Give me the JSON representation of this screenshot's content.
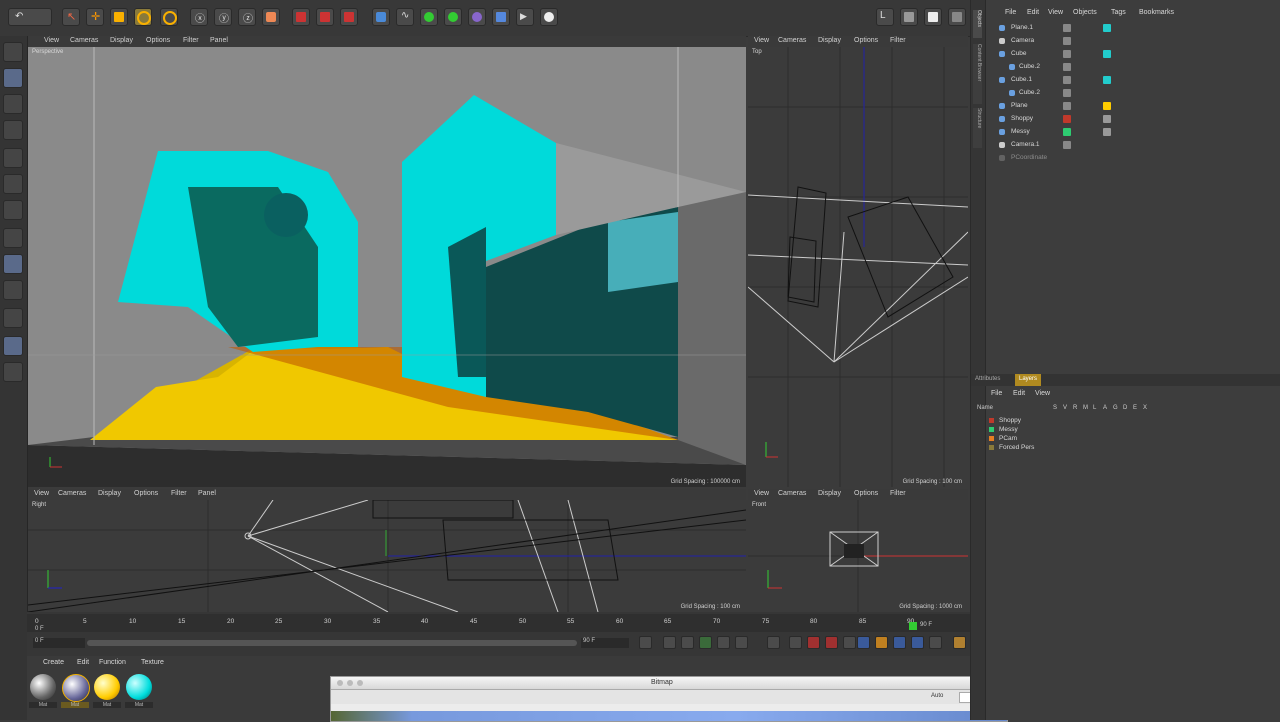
{
  "viewport_menu": [
    "View",
    "Cameras",
    "Display",
    "Options",
    "Filter",
    "Panel"
  ],
  "viewports": {
    "perspective": {
      "label": "Perspective",
      "grid": "Grid Spacing : 100000 cm"
    },
    "top": {
      "label": "Top",
      "grid": "Grid Spacing : 100 cm"
    },
    "right": {
      "label": "Right",
      "grid": "Grid Spacing : 100 cm"
    },
    "front": {
      "label": "Front",
      "grid": "Grid Spacing : 1000 cm"
    }
  },
  "object_manager": {
    "menu": [
      "File",
      "Edit",
      "View",
      "Objects",
      "Tags",
      "Bookmarks"
    ],
    "objects": [
      "Plane.1",
      "Camera",
      "Cube",
      "Cube.2",
      "Cube.1",
      "Cube.2",
      "Plane",
      "Shoppy",
      "Messy",
      "Camera.1",
      "PCoordinate"
    ]
  },
  "layer_manager": {
    "tabs": [
      "Attributes",
      "Layers"
    ],
    "menu": [
      "File",
      "Edit",
      "View"
    ],
    "header": [
      "Name",
      "S",
      "V",
      "R",
      "M",
      "L",
      "A",
      "G",
      "D",
      "E",
      "X"
    ],
    "layers": [
      {
        "name": "Shoppy",
        "color": "#c0392b"
      },
      {
        "name": "Messy",
        "color": "#2ecc71"
      },
      {
        "name": "PCam",
        "color": "#e67e22"
      },
      {
        "name": "Forced Pers",
        "color": "#8a7a3a"
      }
    ]
  },
  "timeline": {
    "ticks": [
      "0",
      "5",
      "10",
      "15",
      "20",
      "25",
      "30",
      "35",
      "40",
      "45",
      "50",
      "55",
      "60",
      "65",
      "70",
      "75",
      "80",
      "85",
      "90"
    ],
    "current_frame": "0 F",
    "start_field": "0 F",
    "end_field": "90 F",
    "end_display": "90 F"
  },
  "material_manager": {
    "menu": [
      "Create",
      "Edit",
      "Function",
      "Texture"
    ],
    "materials": [
      "Mat",
      "Mat",
      "Mat",
      "Mat"
    ]
  },
  "bitmap_window": {
    "title": "Bitmap",
    "auto_label": "Auto"
  },
  "sidebar_labels": [
    "Objects",
    "Content Browser",
    "Structure"
  ]
}
